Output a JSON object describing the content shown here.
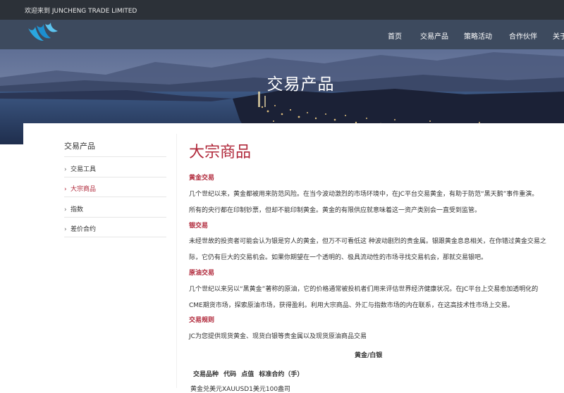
{
  "topbar": {
    "welcome": "欢迎来到 JUNCHENG TRADE LIMITED"
  },
  "nav": {
    "items": [
      "首页",
      "交易产品",
      "策略活动",
      "合作伙伴",
      "关于"
    ]
  },
  "banner": {
    "title": "交易产品"
  },
  "sidebar": {
    "title": "交易产品",
    "items": [
      {
        "label": "交易工具",
        "active": false
      },
      {
        "label": "大宗商品",
        "active": true
      },
      {
        "label": "指数",
        "active": false
      },
      {
        "label": "差价合约",
        "active": false
      }
    ]
  },
  "main": {
    "title": "大宗商品",
    "sections": [
      {
        "heading": "黄金交易",
        "lines": [
          "几个世纪以来，黄金都被用来防范风险。在当今波动激烈的市场环境中，在JC平台交易黄金，有助于防范“黑天鹅”事件重演。",
          "所有的央行都在印制钞票，但却不能印制黄金。黄金的有限供应就意味着这一资产类别会一直受到监管。"
        ]
      },
      {
        "heading": "银交易",
        "lines": [
          "未经世故的投资者可能会认为银是穷人的黄金，但万不可看低这 种波动剧烈的贵金属。银跟黄金息息相关，在你错过黄金交易之",
          "际，它仍有巨大的交易机会。如果你期望在一个透明的、极具流动性的市场寻找交易机会，那就交易银吧。"
        ]
      },
      {
        "heading": "原油交易",
        "lines": [
          "几个世纪以来另以“黑黄金”著称的原油，它的价格通常被投机者们用来评估世界经济健康状况。在JC平台上交易愈加透明化的",
          "CME期货市场，探索原油市场，获得盈利。利用大宗商品、外汇与指数市场的内在联系，在这高技术性市场上交易。"
        ]
      },
      {
        "heading": "交易规则",
        "lines": [
          "JC为您提供现货黄金、现货白银等贵金属以及现货原油商品交易"
        ]
      }
    ],
    "table": {
      "title": "黄金/白银",
      "headers": "交易品种 代码 点值 标准合约（手）",
      "first_cell": "黄金兑美元XAUUSD1美元100盎司"
    }
  },
  "colors": {
    "accent": "#b0283a",
    "topbar": "#2c3138",
    "nav": "#3d4a5e"
  }
}
